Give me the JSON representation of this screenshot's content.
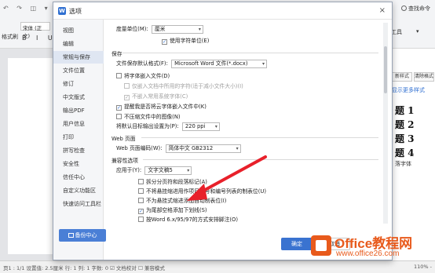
{
  "app": {
    "find_label": "查找命令",
    "font_name": "宋体 (正文)",
    "format_brush": "格式刷",
    "tools_label": "工具",
    "rp_btn1": "新样式",
    "rp_btn2": "清除格式",
    "rp_more": "显示更多样式",
    "headings": [
      "题 1",
      "题 2",
      "题 3",
      "题 4"
    ],
    "rp_text": "落字体",
    "status": "页1 : 1/1   设置值: 2.5厘米   行: 1   列: 1   字数: 0   ☑ 文档校对   ☐ 兼容模式",
    "zoom": "110% -"
  },
  "dialog": {
    "title": "选项",
    "close": "×",
    "nav": [
      "视图",
      "编辑",
      "常规与保存",
      "文件位置",
      "修订",
      "中文版式",
      "输出PDF",
      "用户信息",
      "打印",
      "拼写检查",
      "安全性",
      "信任中心",
      "自定义功能区",
      "快速访问工具栏"
    ],
    "nav_active": 2,
    "backup_label": "备份中心",
    "measure_label": "度量单位(M):",
    "measure_value": "厘米",
    "char_unit_label": "使用字符单位(E)",
    "save_section": "保存",
    "save_format_label": "文件保存默认格式(F):",
    "save_format_value": "Microsoft Word 文件(*.docx)",
    "embed_fonts_label": "将字体嵌入文件(D)",
    "embed_used_label": "仅嵌入文档中所用的字符(适于减小文件大小)(I)",
    "no_common_label": "不嵌入常用系统字体(C)",
    "cloud_remind_label": "提醒我是否将云字体嵌入文件中(K)",
    "no_compress_label": "不压缩文件中的图像(N)",
    "ppi_label": "将默认目标输出设置为(P):",
    "ppi_value": "220 ppi",
    "web_section": "Web 页面",
    "web_encoding_label": "Web 页面编码(W):",
    "web_encoding_value": "简体中文 GB2312",
    "compat_section": "兼容性选项",
    "apply_label": "应用于(Y):",
    "apply_value": "文字文稿5",
    "compat_items": [
      {
        "label": "拆分分页符和段落标记(A)",
        "checked": false
      },
      {
        "label": "不将悬挂缩进用作项目符号和编号列表的制表位(U)",
        "checked": false
      },
      {
        "label": "不为悬挂式缩进添加自动制表位(I)",
        "checked": false
      },
      {
        "label": "为尾部空格添加下划线(S)",
        "checked": true
      },
      {
        "label": "按Word 6.x/95/97的方式安排脚注(O)",
        "checked": false
      }
    ],
    "ok_label": "确定",
    "cancel_label": "取消"
  },
  "watermark": {
    "name": "Office教程网",
    "url": "www.office26.com"
  },
  "colors": {
    "accent": "#3a73d0",
    "arrow": "#e8202a",
    "watermark": "#e85a1c"
  }
}
